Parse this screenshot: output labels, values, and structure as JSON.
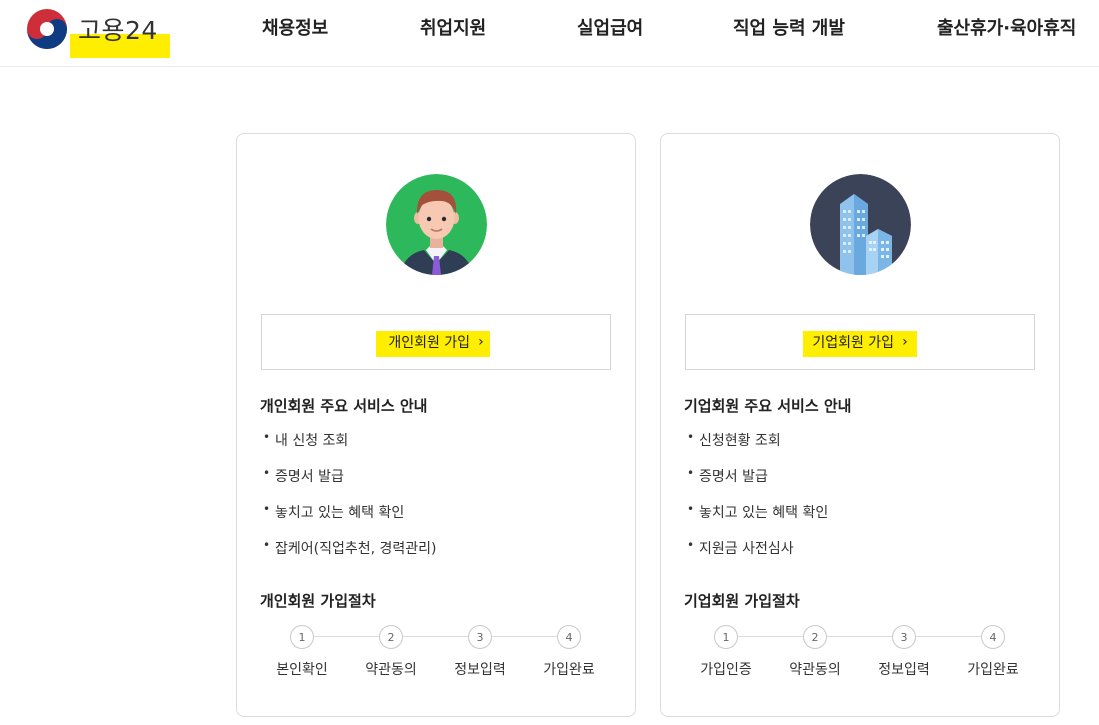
{
  "header": {
    "logo_text": "고용24",
    "nav": [
      "채용정보",
      "취업지원",
      "실업급여",
      "직업 능력 개발",
      "출산휴가·육아휴직"
    ]
  },
  "personal": {
    "button_label": "개인회원 가입",
    "service_title": "개인회원 주요 서비스 안내",
    "services": [
      "내 신청 조회",
      "증명서 발급",
      "놓치고 있는 혜택 확인",
      "잡케어(직업추천, 경력관리)"
    ],
    "steps_title": "개인회원 가입절차",
    "steps": [
      {
        "num": "1",
        "label": "본인확인"
      },
      {
        "num": "2",
        "label": "약관동의"
      },
      {
        "num": "3",
        "label": "정보입력"
      },
      {
        "num": "4",
        "label": "가입완료"
      }
    ]
  },
  "business": {
    "button_label": "기업회원 가입",
    "service_title": "기업회원 주요 서비스 안내",
    "services": [
      "신청현황 조회",
      "증명서 발급",
      "놓치고 있는 혜택 확인",
      "지원금 사전심사"
    ],
    "steps_title": "기업회원 가입절차",
    "steps": [
      {
        "num": "1",
        "label": "가입인증"
      },
      {
        "num": "2",
        "label": "약관동의"
      },
      {
        "num": "3",
        "label": "정보입력"
      },
      {
        "num": "4",
        "label": "가입완료"
      }
    ]
  },
  "icons": {
    "personal": "person-avatar-icon",
    "business": "buildings-icon",
    "chevron": "chevron-right-icon"
  },
  "colors": {
    "highlight": "#ffee00",
    "personal_avatar_bg": "#2eb85c",
    "business_avatar_bg": "#3b4358"
  }
}
